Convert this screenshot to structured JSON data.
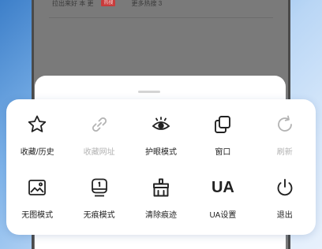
{
  "background": {
    "news_text": "拉出来好 本 更",
    "hot_badge": "热搜",
    "more_hot": "更多热搜 3"
  },
  "menu": {
    "items": [
      {
        "label": "收藏/历史",
        "icon": "star-icon",
        "enabled": true
      },
      {
        "label": "收藏网址",
        "icon": "link-icon",
        "enabled": false
      },
      {
        "label": "护眼模式",
        "icon": "eye-icon",
        "enabled": true
      },
      {
        "label": "窗口",
        "icon": "windows-icon",
        "enabled": true
      },
      {
        "label": "刷新",
        "icon": "refresh-icon",
        "enabled": false
      },
      {
        "label": "无图模式",
        "icon": "image-icon",
        "enabled": true
      },
      {
        "label": "无痕模式",
        "icon": "incognito-icon",
        "enabled": true
      },
      {
        "label": "清除痕迹",
        "icon": "broom-icon",
        "enabled": true
      },
      {
        "label": "UA设置",
        "icon": "ua-icon",
        "icon_text": "UA",
        "enabled": true
      },
      {
        "label": "退出",
        "icon": "power-icon",
        "enabled": true
      }
    ]
  },
  "colors": {
    "icon": "#222222",
    "disabled": "#b3b3b3",
    "panel": "#ffffff",
    "overlay": "#7a7a7a",
    "hot_badge": "#c83b3b"
  }
}
